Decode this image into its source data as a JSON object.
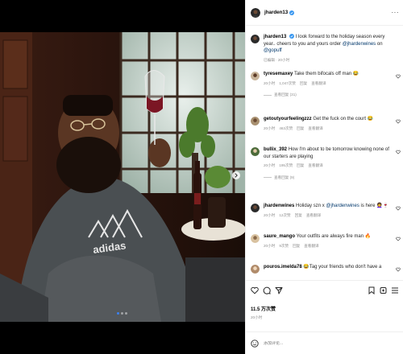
{
  "post": {
    "author": "jharden13",
    "caption_author": "jharden13",
    "caption_text": "I look forward to the holiday season every year.. cheers to you and yours order",
    "caption_mention1": "@jhardenwines",
    "caption_mid": " on ",
    "caption_mention2": "@gopuff",
    "caption_meta": "已编辑 · 20小时",
    "likes": "11.5 万次赞",
    "time": "20小时",
    "add_comment_placeholder": "添加评论..."
  },
  "comments": [
    {
      "user": "tyresemaxey",
      "text": "Take them bifocals off man ",
      "emoji": "😂",
      "time": "20小时",
      "likes": "1,047次赞",
      "reply": "回复",
      "translate": "查看翻译",
      "views": "查看回复 (31)"
    },
    {
      "user": "getoutyourfeelingzzz",
      "text": "Get the fuck on the court ",
      "emoji": "😂",
      "time": "20小时",
      "likes": "463次赞",
      "reply": "回复",
      "translate": "查看翻译"
    },
    {
      "user": "bullix_392",
      "text": "How I'm about to be tomorrow knowing none of our starters are playing",
      "time": "20小时",
      "likes": "195次赞",
      "reply": "回复",
      "translate": "查看翻译",
      "views": "查看回复 (9)"
    },
    {
      "user": "jhardenwines",
      "text": "Holiday szn x ",
      "mention": "@jhardenwines",
      "text2": " is here ",
      "emoji": "👩‍🦱🍷",
      "time": "20小时",
      "likes": "12次赞",
      "reply": "回复",
      "translate": "查看翻译"
    },
    {
      "user": "saure_mango",
      "text": "Your outfits are always fire man ",
      "emoji": "🔥",
      "time": "20小时",
      "likes": "9次赞",
      "reply": "回复",
      "translate": "查看翻译"
    },
    {
      "user": "pouros.imelda78",
      "text": "Tag your friends who don't have a",
      "emoji": "😂",
      "time": "20小时",
      "likes": "",
      "reply": "回复",
      "translate": "查看翻译"
    }
  ],
  "icons": {
    "like": "heart-icon",
    "comment": "comment-icon",
    "share": "share-icon",
    "save": "bookmark-icon",
    "story": "add-story-icon",
    "emoji": "emoji-icon",
    "more": "more-options-icon",
    "next": "chevron-right-icon",
    "verified": "verified-badge-icon"
  },
  "colors": {
    "verified": "#3897f0",
    "link": "#00376b",
    "meta": "#8e8e8e"
  },
  "carousel": {
    "current": 1,
    "total": 3
  }
}
